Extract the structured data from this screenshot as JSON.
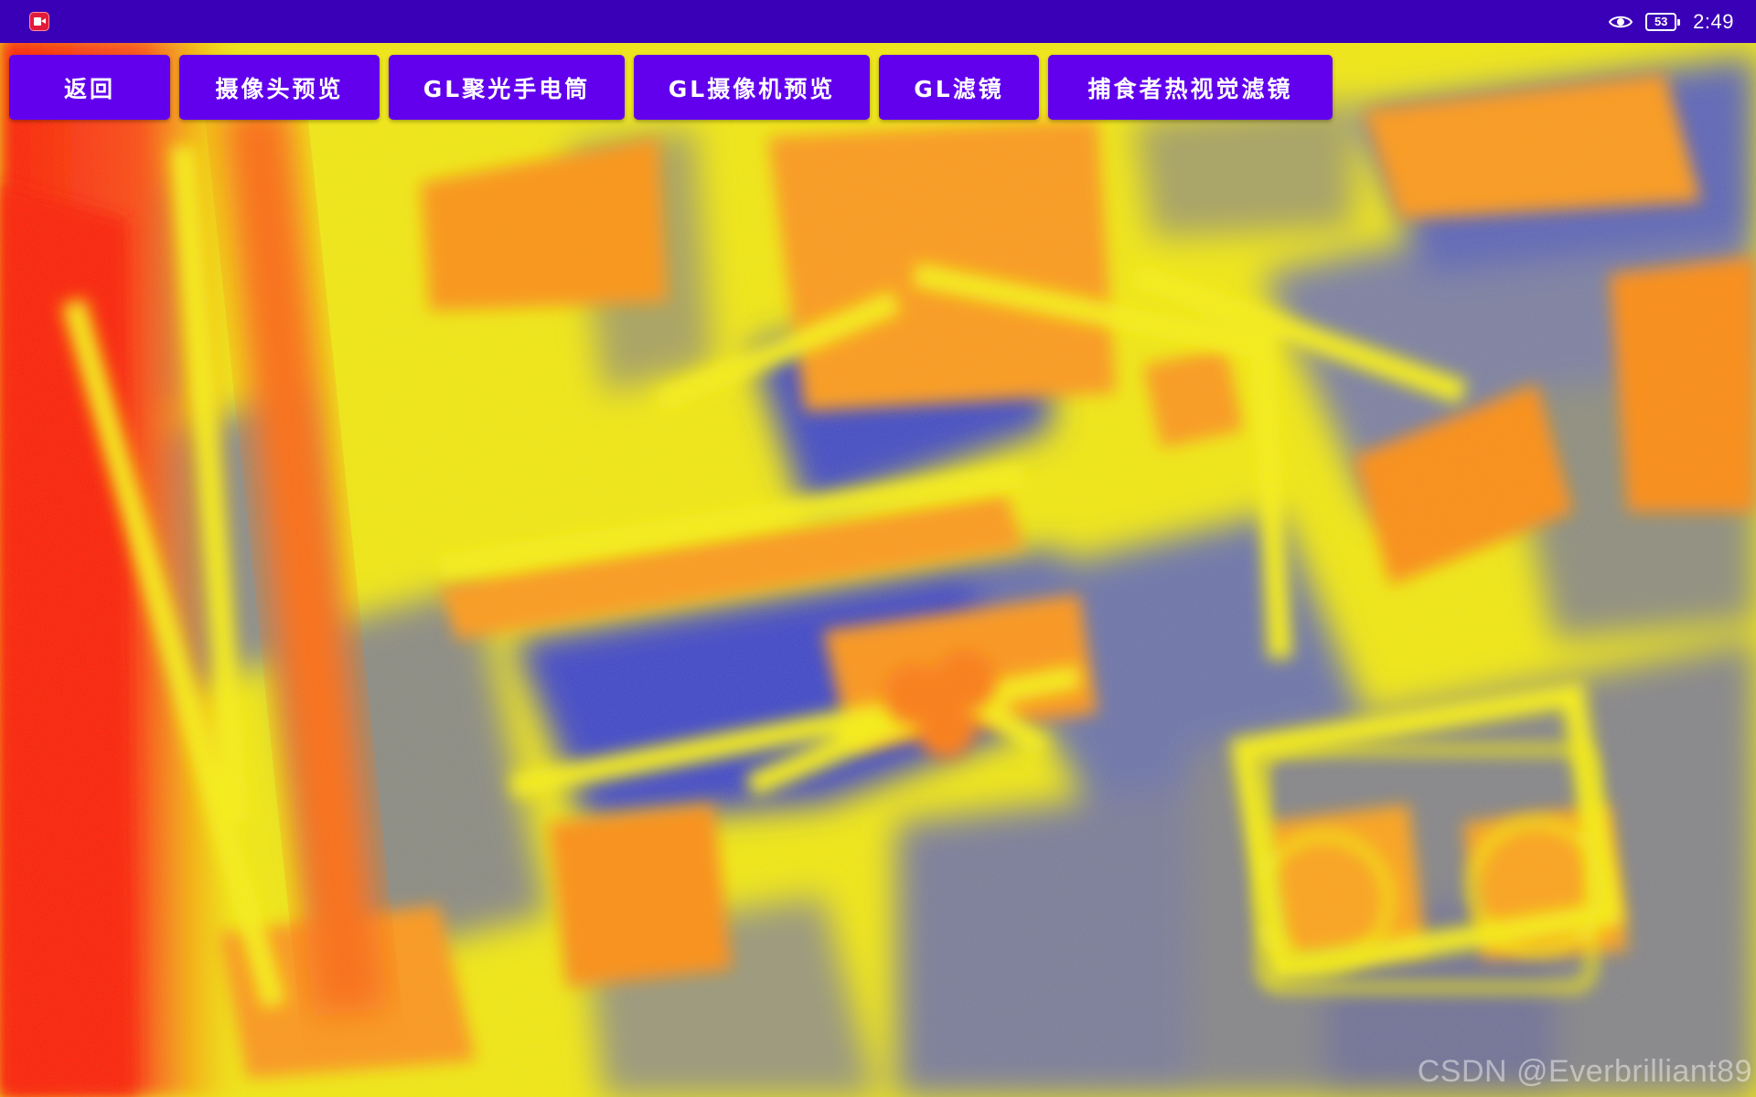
{
  "status_bar": {
    "app_indicator_icon": "video-camera-icon",
    "eye_icon": "eye-icon",
    "battery_level": "53",
    "time": "2:49"
  },
  "buttons": [
    {
      "label": "返回"
    },
    {
      "label": "摄像头预览"
    },
    {
      "label": "GL聚光手电筒"
    },
    {
      "label": "GL摄像机预览"
    },
    {
      "label": "GL滤镜"
    },
    {
      "label": "捕食者热视觉滤镜"
    }
  ],
  "preview": {
    "description_colors": {
      "hot": "#ff2a05",
      "warm": "#ff9a10",
      "mid": "#f7ef0a",
      "cool": "#9c9b6a",
      "cold": "#3b43c6"
    }
  },
  "watermark": "CSDN @Everbrilliant89",
  "colors": {
    "status_bar": "#3a00b7",
    "button": "#6200ee",
    "button_text": "#ffffff"
  }
}
